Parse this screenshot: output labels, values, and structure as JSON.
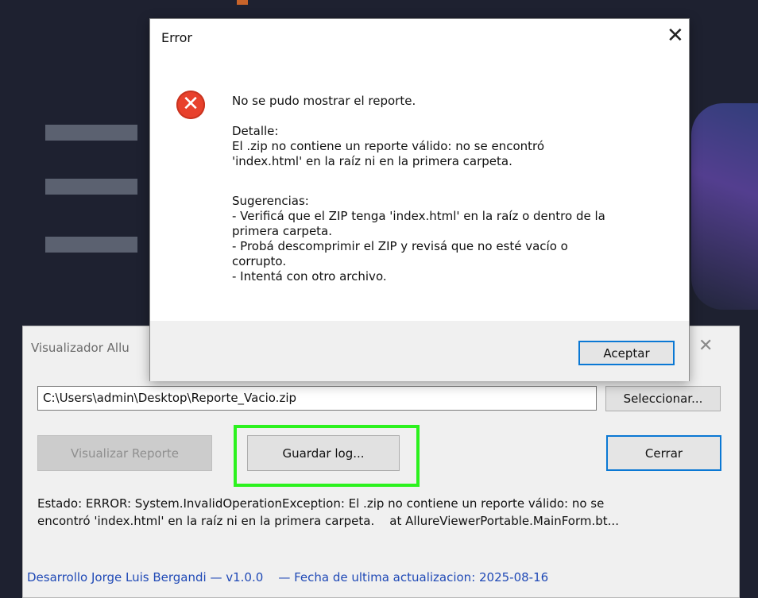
{
  "main_window": {
    "title": "Visualizador Allu",
    "close_glyph": "✕",
    "path_value": "C:\\Users\\admin\\Desktop\\Reporte_Vacio.zip",
    "select_button": "Seleccionar...",
    "view_report_button": "Visualizar Reporte",
    "save_log_button": "Guardar log...",
    "close_button": "Cerrar",
    "status_line1": "Estado: ERROR: System.InvalidOperationException: El .zip no contiene un reporte válido: no se",
    "status_line2": "encontró 'index.html' en la raíz ni en la primera carpeta.    at AllureViewerPortable.MainForm.bt...",
    "footer": "Desarrollo Jorge Luis Bergandi — v1.0.0    — Fecha de ultima actualizacion: 2025-08-16"
  },
  "dialog": {
    "title": "Error",
    "close_glyph": "✕",
    "icon": "error-icon",
    "headline": "No se pudo mostrar el reporte.",
    "detail_label": "Detalle:",
    "detail_line1": "El .zip no contiene un reporte válido: no se encontró",
    "detail_line2": "'index.html' en la raíz ni en la primera carpeta.",
    "suggestions_label": "Sugerencias:",
    "suggestion1_line1": "- Verificá que el ZIP tenga 'index.html' en la raíz o dentro de la",
    "suggestion1_line2": "primera carpeta.",
    "suggestion2_line1": "- Probá descomprimir el ZIP y revisá que no esté vacío o",
    "suggestion2_line2": "corrupto.",
    "suggestion3": "- Intentá con otro archivo.",
    "accept_button": "Aceptar"
  },
  "colors": {
    "highlight": "#2cf21e",
    "focus_border": "#0a78d4",
    "error_icon": "#e8412c",
    "footer_text": "#1f49b6"
  }
}
